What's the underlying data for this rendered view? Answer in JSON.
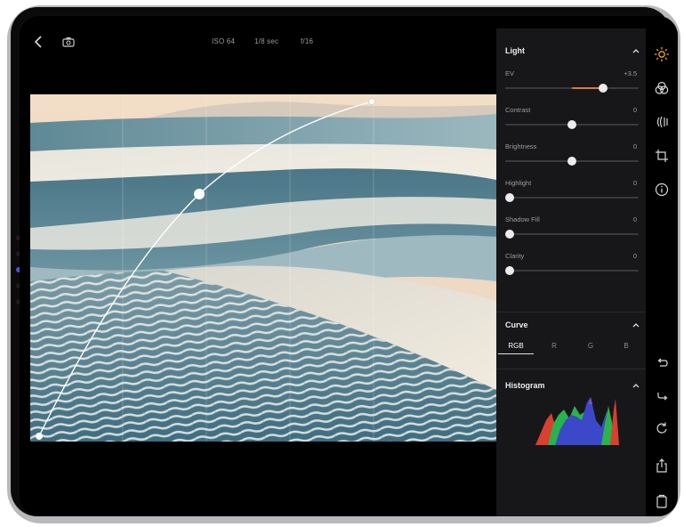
{
  "top_bar": {
    "back_icon": "chevron-left-icon",
    "camera_icon": "camera-icon",
    "iso": "ISO 64",
    "shutter": "1/8 sec",
    "aperture": "f/16"
  },
  "panel": {
    "light": {
      "title": "Light",
      "rows": [
        {
          "label": "EV",
          "value": "+3.5",
          "level": 0.73,
          "fill_from": 0.5
        },
        {
          "label": "Contrast",
          "value": "0",
          "level": 0.5
        },
        {
          "label": "Brightness",
          "value": "0",
          "level": 0.5
        },
        {
          "label": "Highlight",
          "value": "0",
          "level": 0.0
        },
        {
          "label": "Shadow Fill",
          "value": "0",
          "level": 0.0
        },
        {
          "label": "Clarity",
          "value": "0",
          "level": 0.0
        }
      ]
    },
    "curve": {
      "title": "Curve",
      "tabs": [
        "RGB",
        "R",
        "G",
        "B"
      ],
      "active_tab": "RGB"
    },
    "histogram": {
      "title": "Histogram"
    }
  },
  "toolbar": {
    "top_icons": [
      "light-sun-icon",
      "color-icon",
      "effects-icon",
      "crop-icon",
      "info-icon"
    ],
    "bottom_icons": [
      "undo-icon",
      "redo-icon",
      "reset-icon",
      "share-icon",
      "copy-icon"
    ]
  },
  "colors": {
    "accent": "#d87a3a",
    "active_tool": "#f0a53a",
    "panel_bg": "#17171a"
  }
}
